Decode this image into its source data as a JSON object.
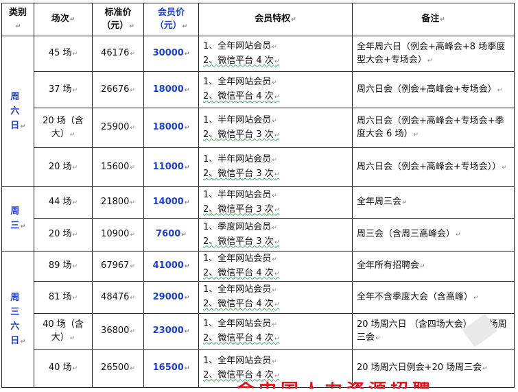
{
  "headers": {
    "category": "类别",
    "sessions": "场次",
    "standard_price": "标准价（元）",
    "member_price": "会员价（元）",
    "privileges": "会员特权",
    "notes": "备注"
  },
  "groups": [
    {
      "category": "周六日",
      "rows": [
        {
          "sessions": "45 场",
          "standard_price": "46176",
          "member_price": "30000",
          "privilege_1": "1、全年网站会员",
          "privilege_2": "2、微信平台 4 次",
          "notes": "全年周六日（例会+高峰会+8 场季度型大会+专场会）"
        },
        {
          "sessions": "37 场",
          "standard_price": "26676",
          "member_price": "18000",
          "privilege_1": "1、全年网站会员",
          "privilege_2": "2、微信平台 4 次",
          "notes": "周六日会（例会+高峰会+专场会）"
        },
        {
          "sessions": "20 场（含大）",
          "standard_price": "25900",
          "member_price": "18000",
          "privilege_1": "1、半年网站会员",
          "privilege_2": "2、微信平台 3 次",
          "notes": "周六日会（例会+高峰会+专场会+季度大会 6 场）"
        },
        {
          "sessions": "20 场",
          "standard_price": "15600",
          "member_price": "11000",
          "privilege_1": "1、半年网站会员",
          "privilege_2": "2、微信平台 3 次",
          "notes": "周六日会（例会+高峰会+专场会））"
        }
      ]
    },
    {
      "category": "周三",
      "rows": [
        {
          "sessions": "44 场",
          "standard_price": "21800",
          "member_price": "14000",
          "privilege_1": "1、半年网站会员",
          "privilege_2": "2、微信平台 3 次",
          "notes": "全年周三会"
        },
        {
          "sessions": "20 场",
          "standard_price": "10900",
          "member_price": "7600",
          "privilege_1": "1、季度网站会员",
          "privilege_2": "2、微信平台 3 次",
          "notes": "周三会（含周三高峰会）"
        }
      ]
    },
    {
      "category": "周三六日",
      "rows": [
        {
          "sessions": "89 场",
          "standard_price": "67967",
          "member_price": "41000",
          "privilege_1": "1、全年网站会员",
          "privilege_2": "2、微信平台 4 次",
          "notes": "全年所有招聘会"
        },
        {
          "sessions": "81 场",
          "standard_price": "48476",
          "member_price": "29000",
          "privilege_1": "1、全年网站会员",
          "privilege_2": "2、微信平台 4 次",
          "notes": "全年不含季度大会（含高峰）"
        },
        {
          "sessions": "40 场（含大）",
          "standard_price": "36800",
          "member_price": "23000",
          "privilege_1": "1、全年网站会员",
          "privilege_2": "2、微信平台 4 次",
          "notes": "20 场周六日 （含四场大会） 20 场周三会"
        },
        {
          "sessions": "40 场",
          "standard_price": "26500",
          "member_price": "16500",
          "privilege_1": "1、全年网站会员",
          "privilege_2": "2、微信平台 4 次",
          "notes": "20 场周六日例会+20 场周三会"
        }
      ]
    }
  ],
  "footer_fragment": "会中国人力资源招聘"
}
